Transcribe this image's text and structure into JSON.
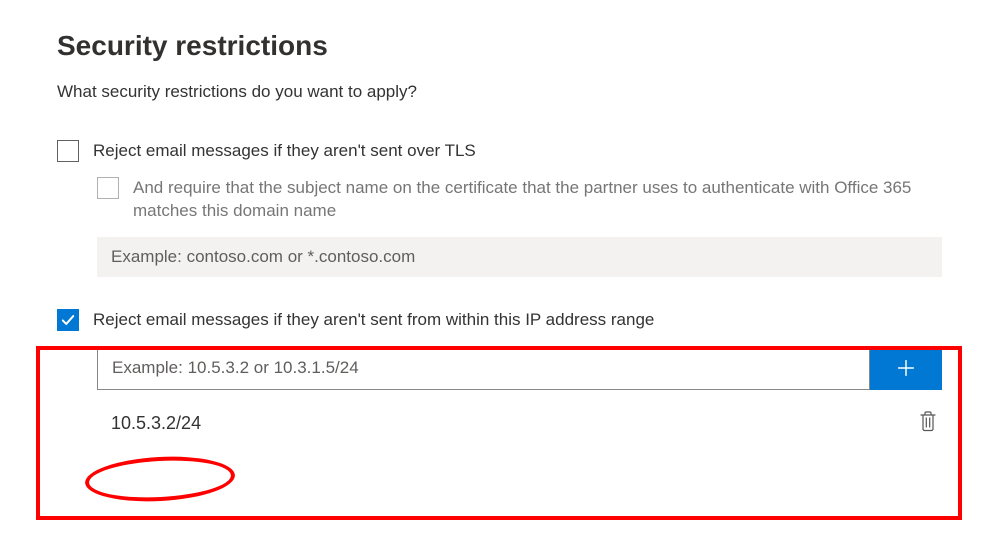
{
  "title": "Security restrictions",
  "subtitle": "What security restrictions do you want to apply?",
  "tls": {
    "checked": false,
    "label": "Reject email messages if they aren't sent over TLS",
    "sub": {
      "checked": false,
      "label": "And require that the subject name on the certificate that the partner uses to authenticate with Office 365 matches this domain name",
      "placeholder": "Example: contoso.com or *.contoso.com"
    }
  },
  "ip": {
    "checked": true,
    "label": "Reject email messages if they aren't sent from within this IP address range",
    "placeholder": "Example: 10.5.3.2 or 10.3.1.5/24",
    "entries": [
      "10.5.3.2/24"
    ]
  }
}
